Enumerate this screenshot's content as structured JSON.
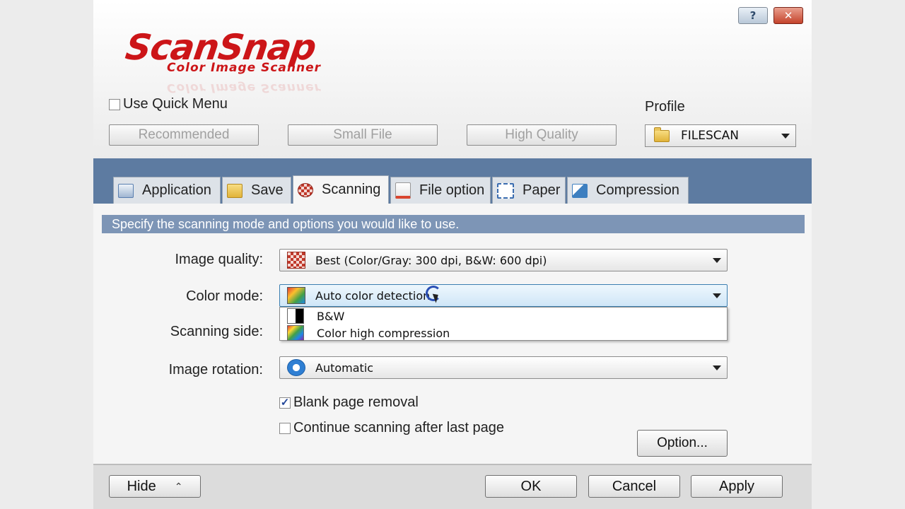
{
  "window": {
    "help_label": "?",
    "close_label": "✕"
  },
  "logo": {
    "main": "ScanSnap",
    "sub": "Color Image Scanner"
  },
  "quick_menu": {
    "label": "Use Quick Menu",
    "checked": false
  },
  "presets": [
    "Recommended",
    "Small File",
    "High Quality"
  ],
  "profile": {
    "label": "Profile",
    "value": "FILESCAN",
    "icon": "folder-icon"
  },
  "tabs": [
    {
      "label": "Application",
      "icon": "application-icon",
      "color": "#5a7fb0"
    },
    {
      "label": "Save",
      "icon": "folder-icon",
      "color": "#e1b339"
    },
    {
      "label": "Scanning",
      "icon": "scanning-icon",
      "color": "#c0392b",
      "active": true
    },
    {
      "label": "File option",
      "icon": "file-option-icon",
      "color": "#d9462f"
    },
    {
      "label": "Paper",
      "icon": "paper-icon",
      "color": "#3b6db0"
    },
    {
      "label": "Compression",
      "icon": "compression-icon",
      "color": "#3d7fc0"
    }
  ],
  "info": "Specify the scanning mode and options you would like to use.",
  "fields": {
    "image_quality": {
      "label": "Image quality:",
      "value": "Best (Color/Gray: 300 dpi, B&W: 600 dpi)"
    },
    "color_mode": {
      "label": "Color mode:",
      "value": "Auto color detection"
    },
    "scanning_side": {
      "label": "Scanning side:"
    },
    "image_rotation": {
      "label": "Image rotation:",
      "value": "Automatic"
    }
  },
  "color_mode_options": [
    "B&W",
    "Color high compression"
  ],
  "checkboxes": [
    {
      "label": "Blank page removal",
      "checked": true
    },
    {
      "label": "Continue scanning after last page",
      "checked": false
    }
  ],
  "option_button": "Option...",
  "footer": {
    "hide": "Hide",
    "ok": "OK",
    "cancel": "Cancel",
    "apply": "Apply"
  },
  "colors": {
    "brand_red": "#cc1518",
    "tab_band": "#5d7ba1",
    "info_bar": "#7d95b6"
  }
}
